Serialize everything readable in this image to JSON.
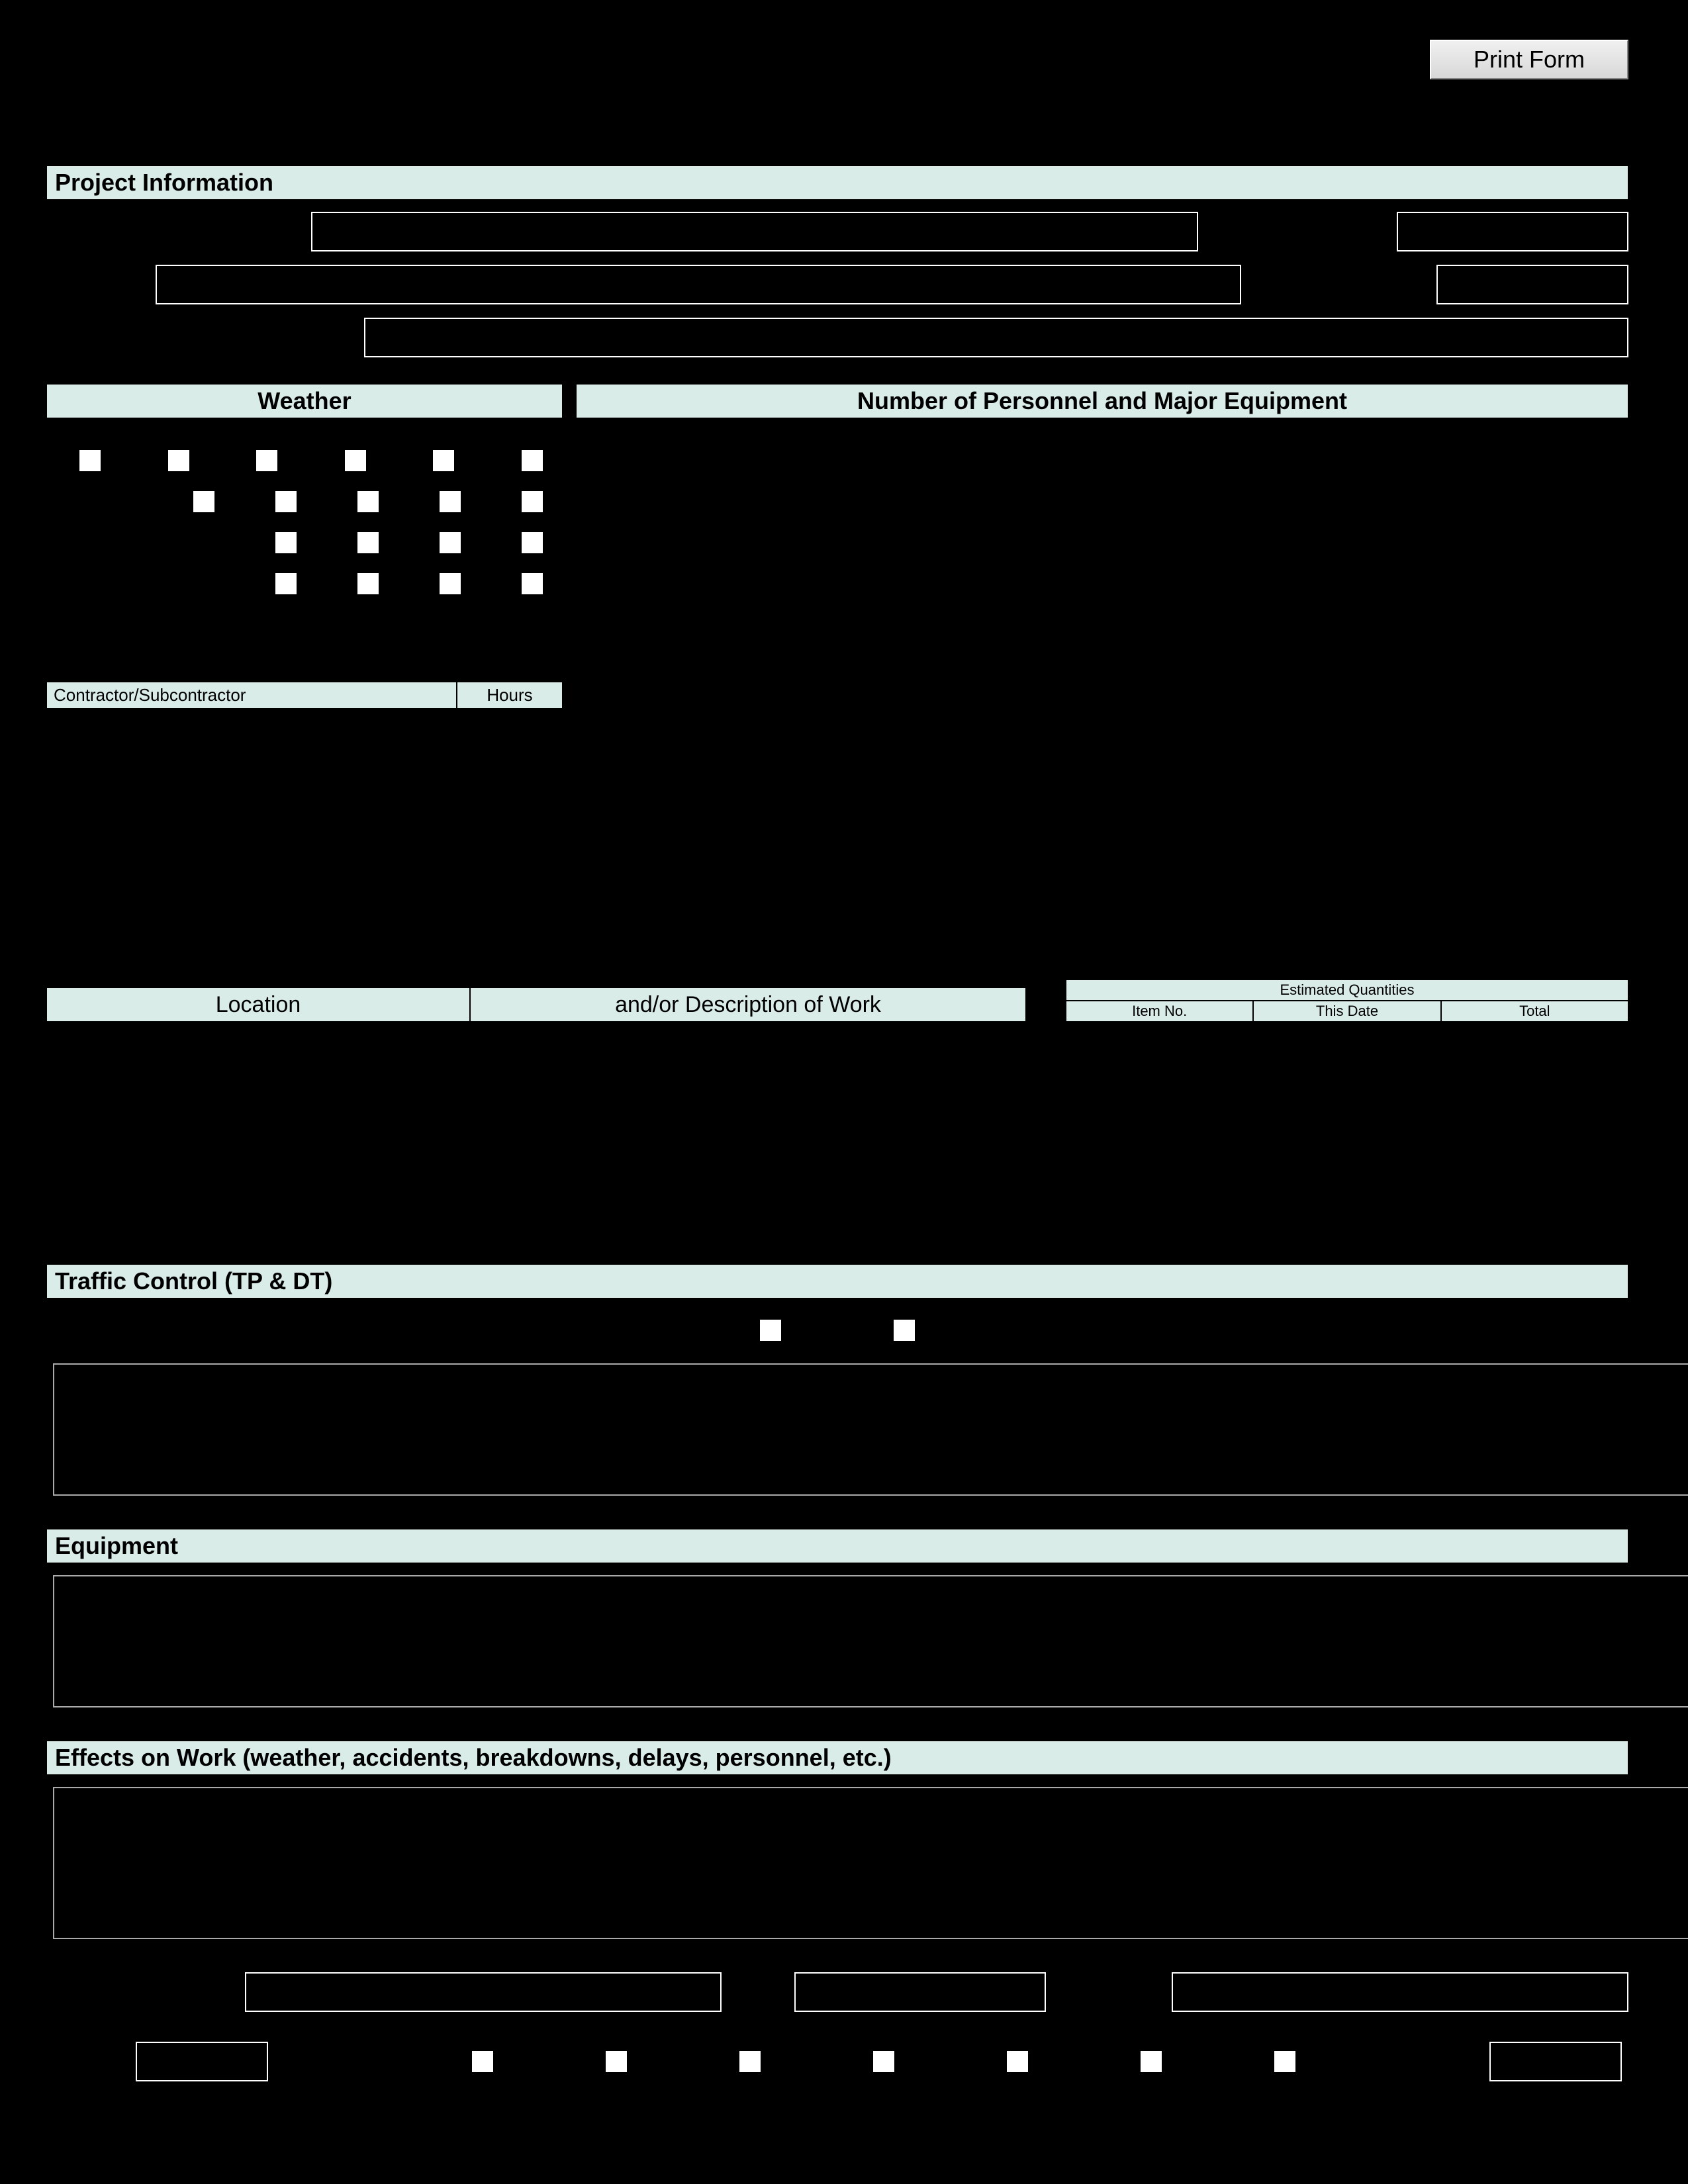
{
  "buttons": {
    "print": "Print Form"
  },
  "sections": {
    "project_info": "Project Information",
    "weather": "Weather",
    "personnel": "Number of Personnel and Major Equipment",
    "contractor_sub": "Contractor/Subcontractor",
    "hours": "Hours",
    "location": "Location",
    "desc_work": "and/or Description of Work",
    "est_qty": "Estimated Quantities",
    "item_no": "Item No.",
    "this_date": "This Date",
    "total": "Total",
    "traffic": "Traffic Control (TP & DT)",
    "equipment": "Equipment",
    "effects": "Effects on Work (weather, accidents, breakdowns, delays, personnel, etc.)"
  }
}
